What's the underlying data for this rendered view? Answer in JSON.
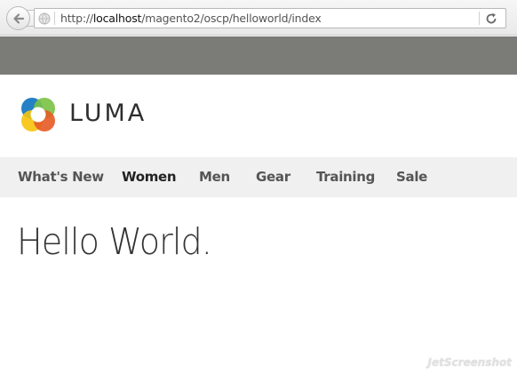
{
  "browser": {
    "url_prefix": "http://",
    "url_host": "localhost",
    "url_path": "/magento2/oscp/helloworld/index"
  },
  "logo": {
    "text": "LUMA",
    "colors": [
      "#1979c3",
      "#f6c30a",
      "#e75a24",
      "#7ac143"
    ]
  },
  "nav": {
    "items": [
      {
        "label": "What's New"
      },
      {
        "label": "Women"
      },
      {
        "label": "Men"
      },
      {
        "label": "Gear"
      },
      {
        "label": "Training"
      },
      {
        "label": "Sale"
      }
    ],
    "active": "Women"
  },
  "main": {
    "title": "Hello World."
  },
  "watermark": {
    "text": "JetScreenshot"
  }
}
